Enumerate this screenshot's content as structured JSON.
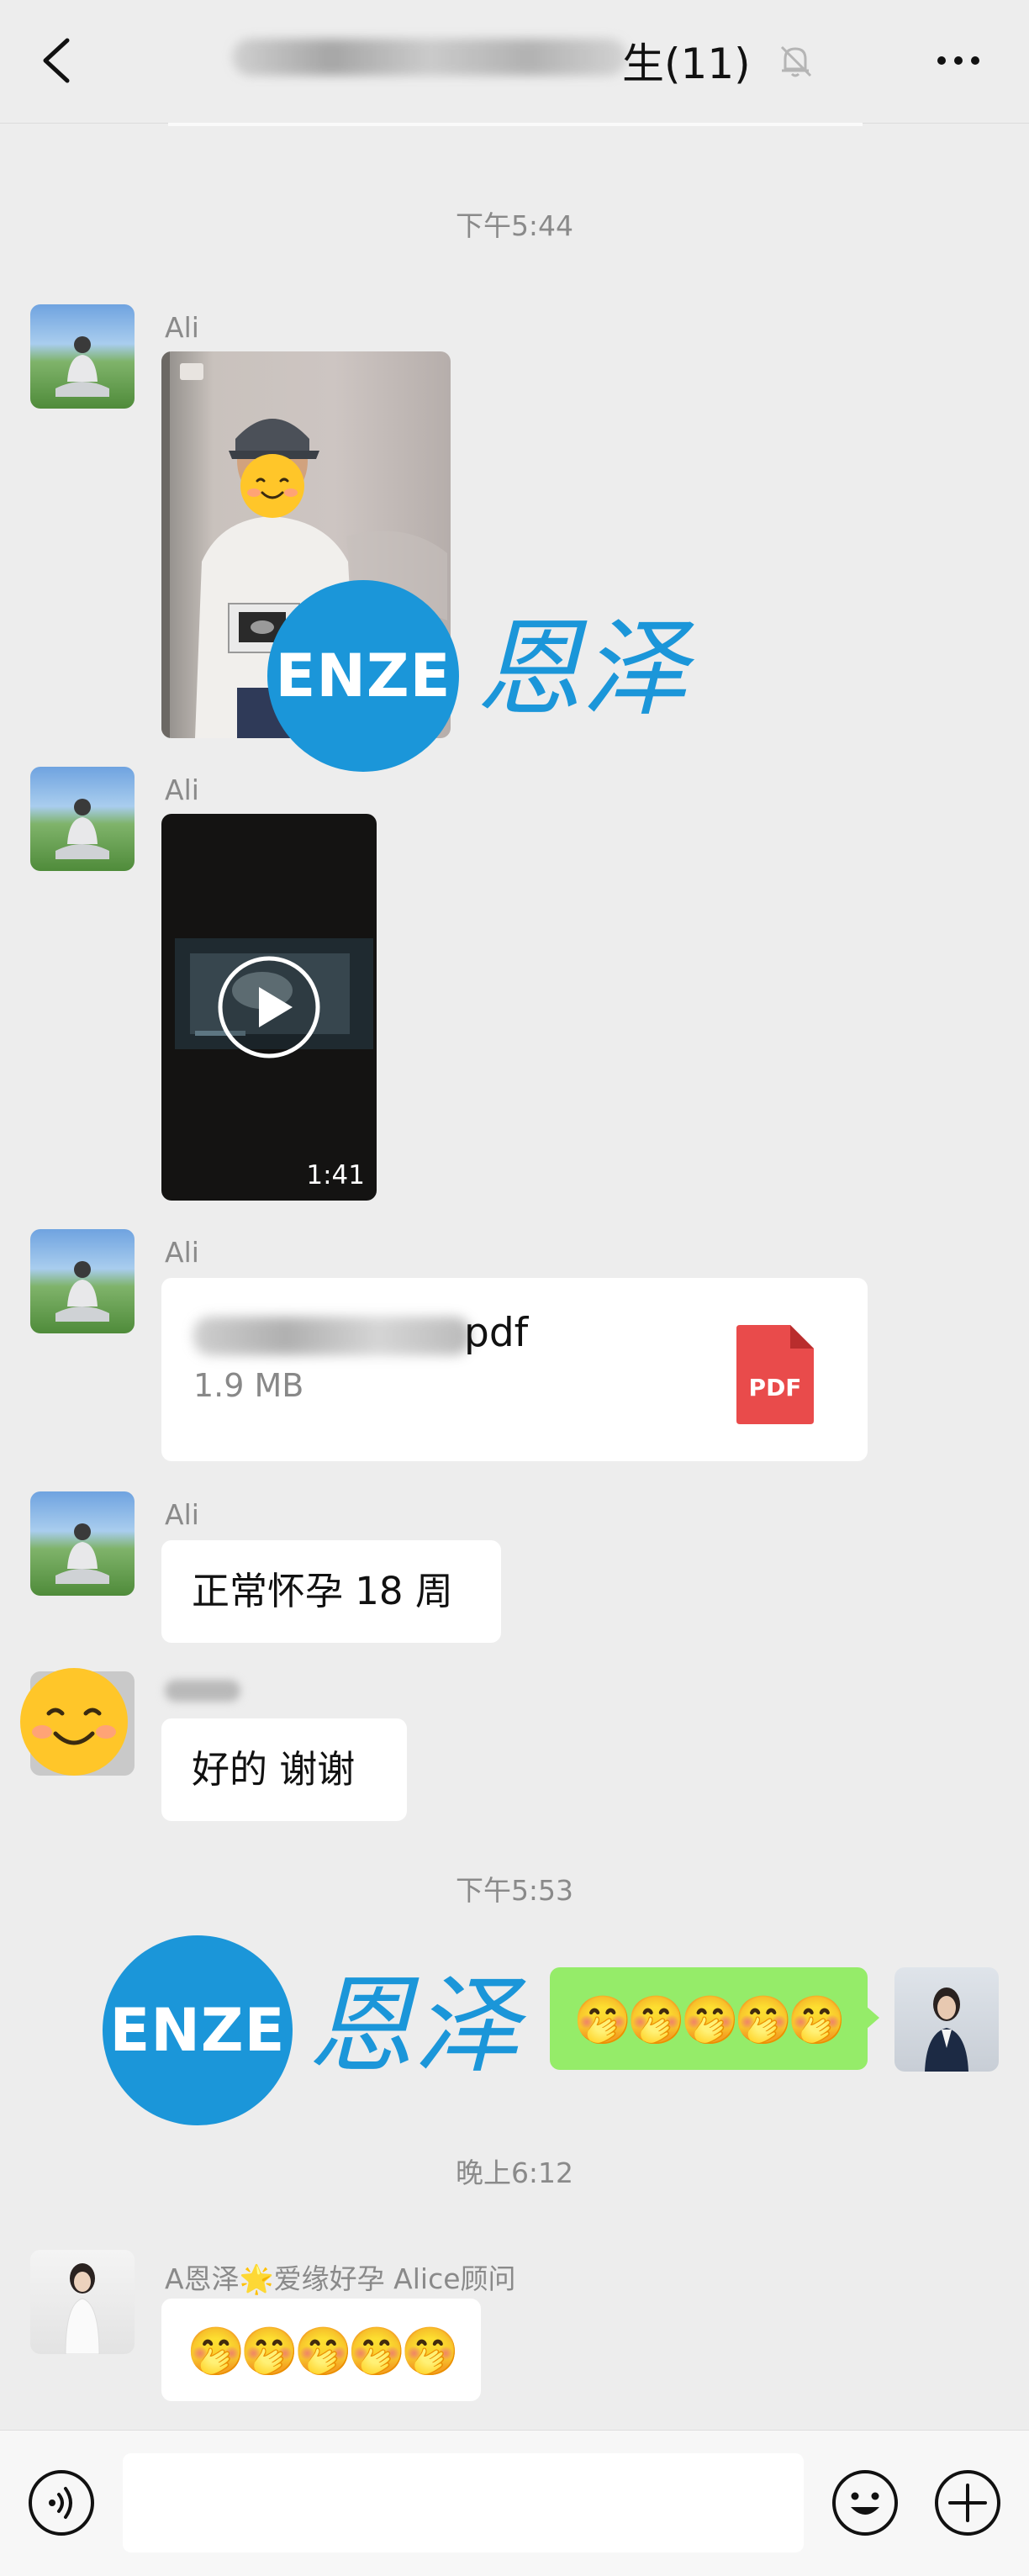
{
  "header": {
    "title_suffix": "生(11)",
    "back_icon": "back-chevron-icon",
    "mute_icon": "bell-muted-icon",
    "more_icon": "more-dots-icon"
  },
  "messages": {
    "time1": "下午5:44",
    "m1_name": "Ali",
    "m2_name": "Ali",
    "video_duration": "1:41",
    "m3_name": "Ali",
    "file_name_visible": "pdf",
    "file_size": "1.9 MB",
    "file_badge": "PDF",
    "m4_name": "Ali",
    "m4_text": "正常怀孕 18 周",
    "m5_text": "好的 谢谢",
    "time2": "下午5:53",
    "self_emojis": "🤭🤭🤭🤭🤭",
    "time3": "晚上6:12",
    "m7_name": "A恩泽🌟爱缘好孕 Alice顾问",
    "m7_emojis": "🤭🤭🤭🤭🤭"
  },
  "watermark": {
    "en": "ENZE",
    "cn": "恩泽"
  },
  "bottom_bar": {
    "voice_icon": "voice-icon",
    "emoji_icon": "emoji-icon",
    "plus_icon": "plus-icon"
  },
  "colors": {
    "background": "#ededed",
    "self_bubble": "#95ec69",
    "brand_blue": "#1b96d9",
    "pdf_red": "#e94b4b"
  }
}
